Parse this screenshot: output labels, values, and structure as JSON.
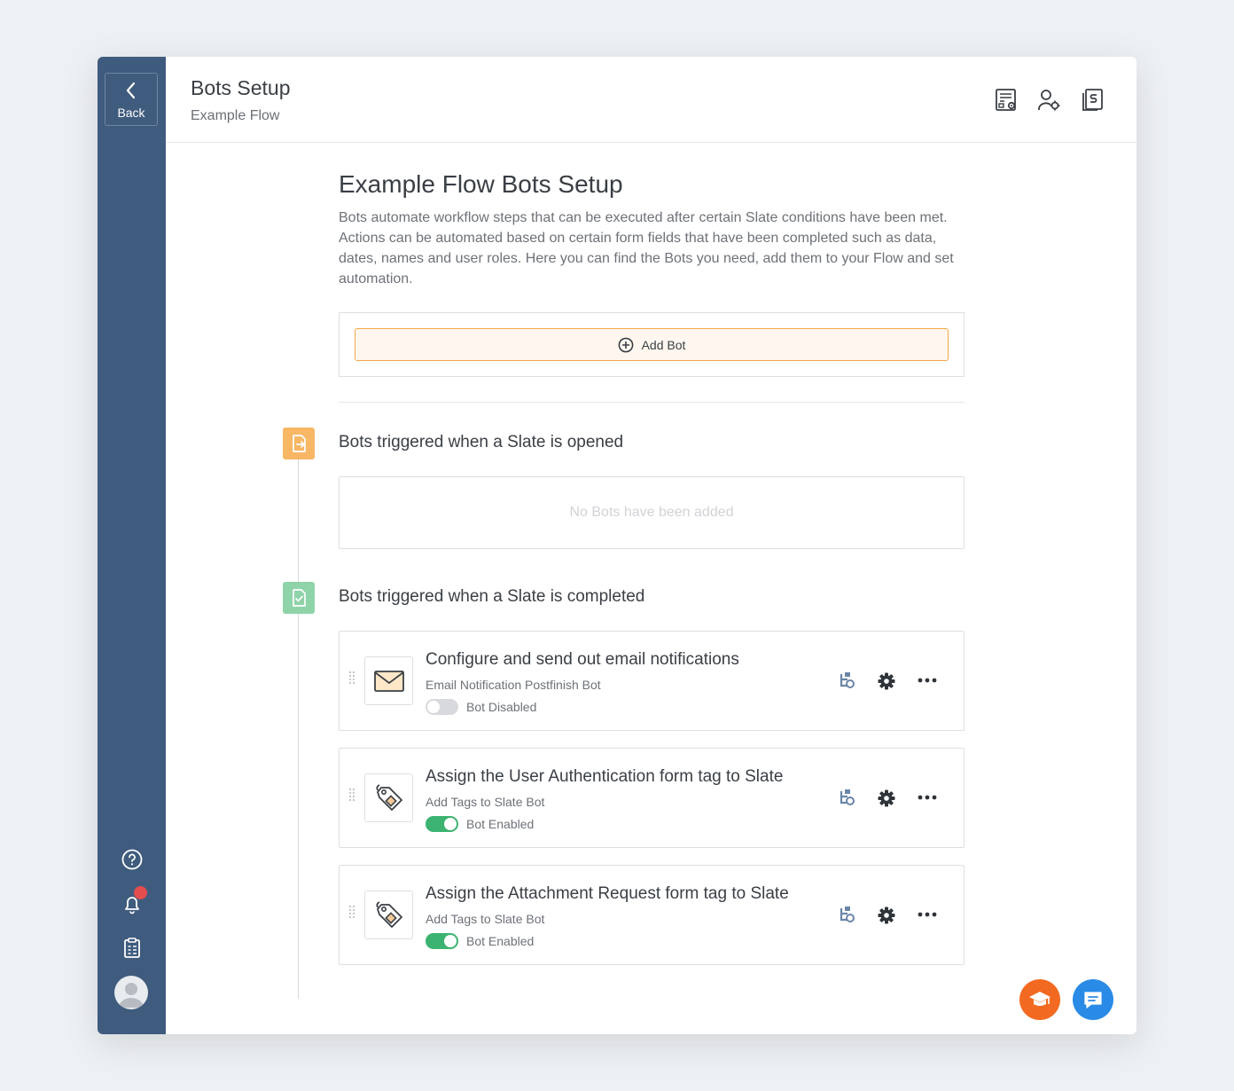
{
  "sidebar": {
    "back_label": "Back"
  },
  "header": {
    "title": "Bots Setup",
    "subtitle": "Example Flow"
  },
  "main": {
    "heading": "Example Flow Bots Setup",
    "description": "Bots automate workflow steps that can be executed after certain Slate conditions have been met. Actions can be automated based on certain form fields that have been completed such as data, dates, names and user roles. Here you can find the Bots you need, add them to your Flow and set automation.",
    "add_bot_label": "Add Bot"
  },
  "sections": [
    {
      "title": "Bots triggered when a Slate is opened",
      "empty_text": "No Bots have been added",
      "color": "#f7b765"
    },
    {
      "title": "Bots triggered when a Slate is completed",
      "color": "#8fd3a9"
    }
  ],
  "bots": [
    {
      "title": "Configure and send out email notifications",
      "type": "Email Notification Postfinish Bot",
      "status": "Bot Disabled",
      "enabled": false,
      "icon": "envelope-icon"
    },
    {
      "title": "Assign the User Authentication form tag to Slate",
      "type": "Add Tags to Slate Bot",
      "status": "Bot Enabled",
      "enabled": true,
      "icon": "tag-icon"
    },
    {
      "title": "Assign the Attachment Request form tag to Slate",
      "type": "Add Tags to Slate Bot",
      "status": "Bot Enabled",
      "enabled": true,
      "icon": "tag-icon"
    }
  ],
  "colors": {
    "sidebar": "#3f5c7e",
    "accent_orange": "#f2a84a",
    "enabled_green": "#3cb371",
    "fab_orange": "#f26a21",
    "fab_blue": "#2a8be6",
    "notification_red": "#e34d4d"
  }
}
